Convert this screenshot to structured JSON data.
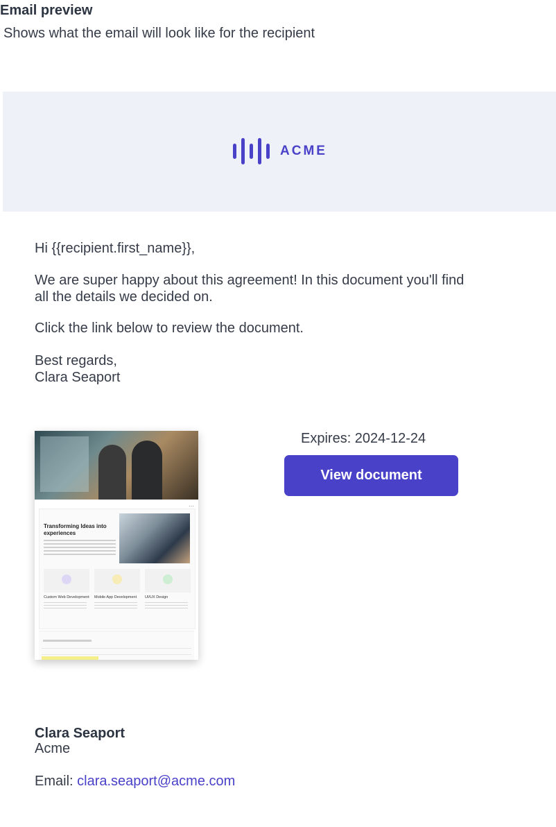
{
  "header": {
    "title": "Email preview",
    "subtitle": "Shows what the email will look like for the recipient"
  },
  "brand": {
    "logo_text": "ACME",
    "accent_color": "#4a41c9",
    "banner_color": "#eef1f7"
  },
  "email": {
    "greeting": "Hi {{recipient.first_name}},",
    "paragraph1": "We are super happy about this agreement! In this document you'll find\nall the details we decided on.",
    "paragraph2": "Click the link below to review the document.",
    "closing": "Best regards,\nClara Seaport"
  },
  "document": {
    "preview_heading": "Transforming Ideas into experiences",
    "features": [
      "Custom Web Development",
      "Mobile App Development",
      "UI/UX Design"
    ],
    "expires_label": "Expires: 2024-12-24",
    "button_label": "View document"
  },
  "signature": {
    "name": "Clara Seaport",
    "company": "Acme",
    "email_label": "Email: ",
    "email": "clara.seaport@acme.com"
  }
}
